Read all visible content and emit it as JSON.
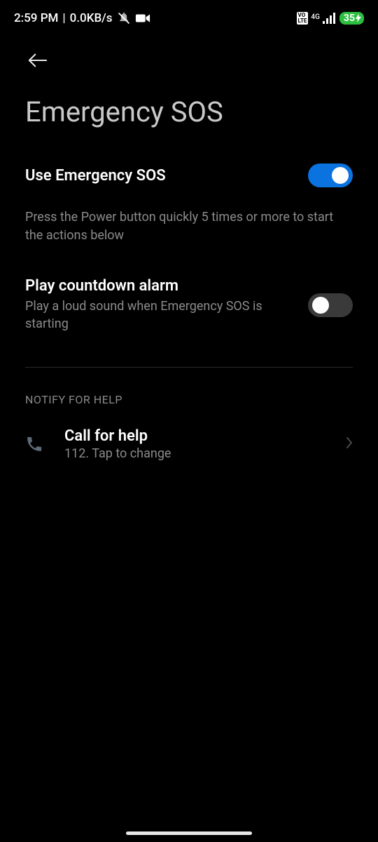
{
  "statusbar": {
    "time": "2:59 PM",
    "separator": " | ",
    "speed": "0.0KB/s",
    "volte_label": "VO\nLTE",
    "network_label": "4G",
    "battery_text": "35"
  },
  "page": {
    "title": "Emergency SOS"
  },
  "settings": {
    "use_sos": {
      "title": "Use Emergency SOS",
      "enabled": true,
      "description": "Press the Power button quickly 5 times or more to start the actions below"
    },
    "countdown_alarm": {
      "title": "Play countdown alarm",
      "subtitle": "Play a loud sound when Emergency SOS is starting",
      "enabled": false
    }
  },
  "sections": {
    "notify_header": "NOTIFY FOR HELP",
    "call_for_help": {
      "title": "Call for help",
      "subtitle": "112. Tap to change"
    }
  }
}
